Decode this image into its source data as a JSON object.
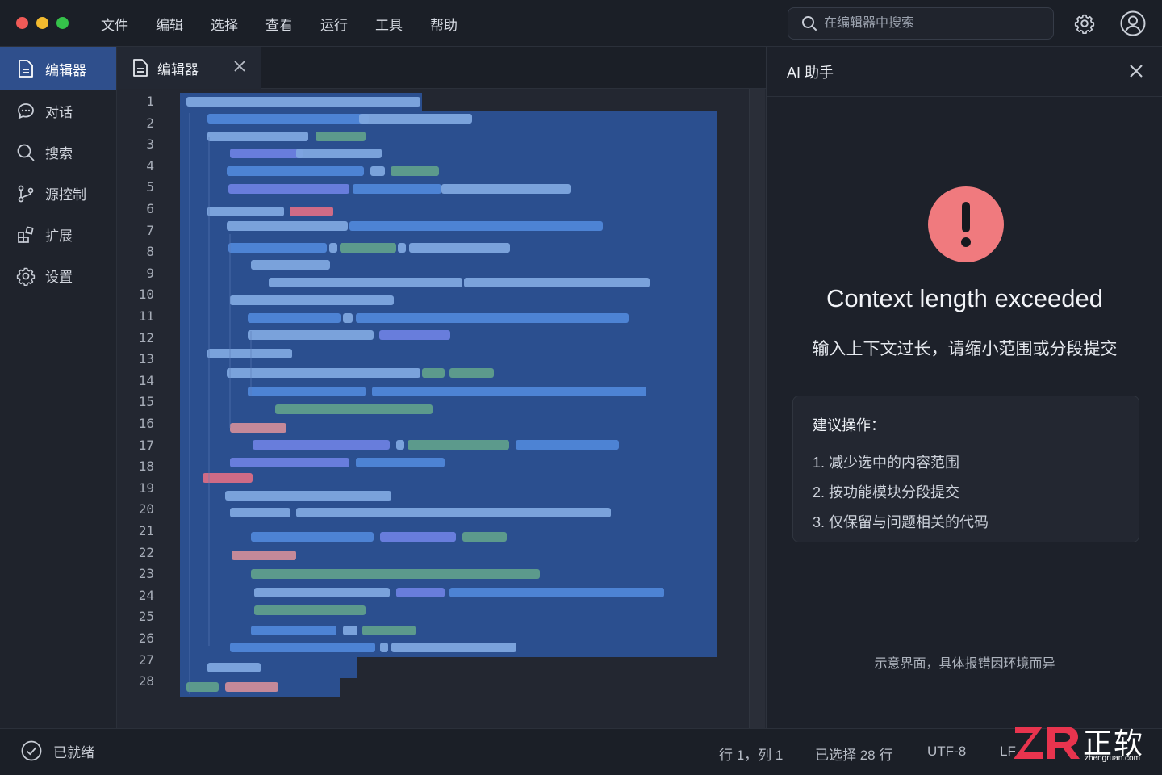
{
  "menu": [
    "文件",
    "编辑",
    "选择",
    "查看",
    "运行",
    "工具",
    "帮助"
  ],
  "search": {
    "placeholder": "在编辑器中搜索"
  },
  "sidebar": {
    "items": [
      {
        "label": "编辑器",
        "icon": "file-icon",
        "active": true
      },
      {
        "label": "对话",
        "icon": "chat-icon"
      },
      {
        "label": "搜索",
        "icon": "search-icon"
      },
      {
        "label": "源控制",
        "icon": "git-branch-icon"
      },
      {
        "label": "扩展",
        "icon": "extensions-icon"
      },
      {
        "label": "设置",
        "icon": "gear-icon"
      }
    ]
  },
  "editor": {
    "tab_label": "编辑器",
    "line_numbers": [
      "1",
      "2",
      "3",
      "4",
      "5",
      "6",
      "7",
      "8",
      "9",
      "10",
      "11",
      "12",
      "13",
      "14",
      "15",
      "16",
      "17",
      "18",
      "19",
      "20",
      "21",
      "22",
      "23",
      "24",
      "25",
      "26",
      "27",
      "28"
    ]
  },
  "panel": {
    "title": "AI 助手",
    "error_title": "Context length exceeded",
    "error_subtitle": "输入上下文过长，请缩小范围或分段提交",
    "suggest_title": "建议操作：",
    "suggestions": [
      "1.  减少选中的内容范围",
      "2.  按功能模块分段提交",
      "3.  仅保留与问题相关的代码"
    ],
    "footnote": "示意界面，具体报错因环境而异"
  },
  "status": {
    "ready": "已就绪",
    "position": "行 1，列 1",
    "selection": "已选择 28 行",
    "encoding": "UTF-8",
    "eol": "LF"
  },
  "watermark": {
    "text": "正软",
    "url": "zhengruan.com"
  },
  "colors": {
    "accent": "#2f4f8c",
    "selection": "#2b4f8f",
    "error": "#f07a7e"
  }
}
